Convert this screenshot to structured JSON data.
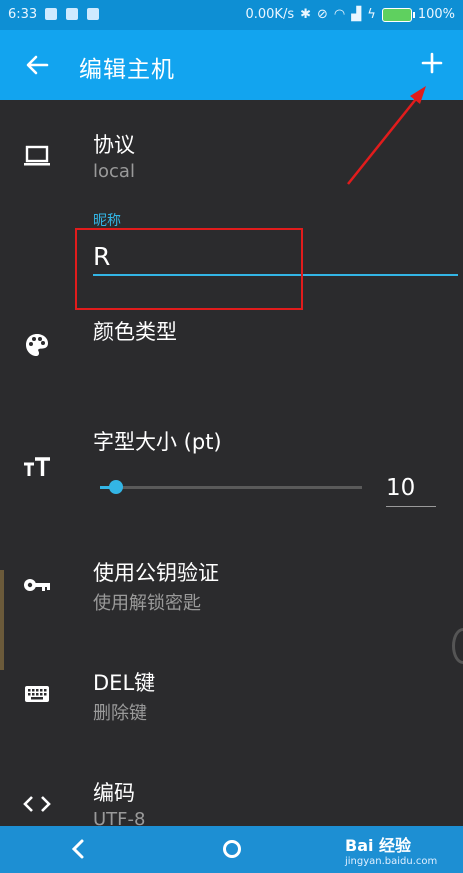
{
  "status_bar": {
    "time": "6:33",
    "network_speed": "0.00K/s",
    "battery_percent": "100%"
  },
  "app_bar": {
    "title": "编辑主机",
    "back_icon": "arrow-left-icon",
    "add_icon": "plus-icon"
  },
  "settings": {
    "protocol": {
      "label": "协议",
      "value": "local",
      "icon": "laptop-icon"
    },
    "nickname": {
      "label": "昵称",
      "value": "R"
    },
    "color": {
      "label": "颜色类型",
      "icon": "palette-icon"
    },
    "font_size": {
      "label": "字型大小 (pt)",
      "value": "10",
      "slider_fraction": 0.06,
      "icon": "text-size-icon"
    },
    "pubkey": {
      "label": "使用公钥验证",
      "value": "使用解锁密匙",
      "icon": "key-icon"
    },
    "del_key": {
      "label": "DEL键",
      "value": "删除键",
      "icon": "keyboard-icon"
    },
    "encoding": {
      "label": "编码",
      "value": "UTF-8",
      "icon": "code-icon"
    }
  },
  "watermark": {
    "line1": "Bai 经验",
    "line2": "jingyan.baidu.com"
  },
  "colors": {
    "accent": "#33b5e5",
    "app_bar": "#12a4ef",
    "background": "#2b2b2d",
    "annotation": "#e11c1c"
  }
}
